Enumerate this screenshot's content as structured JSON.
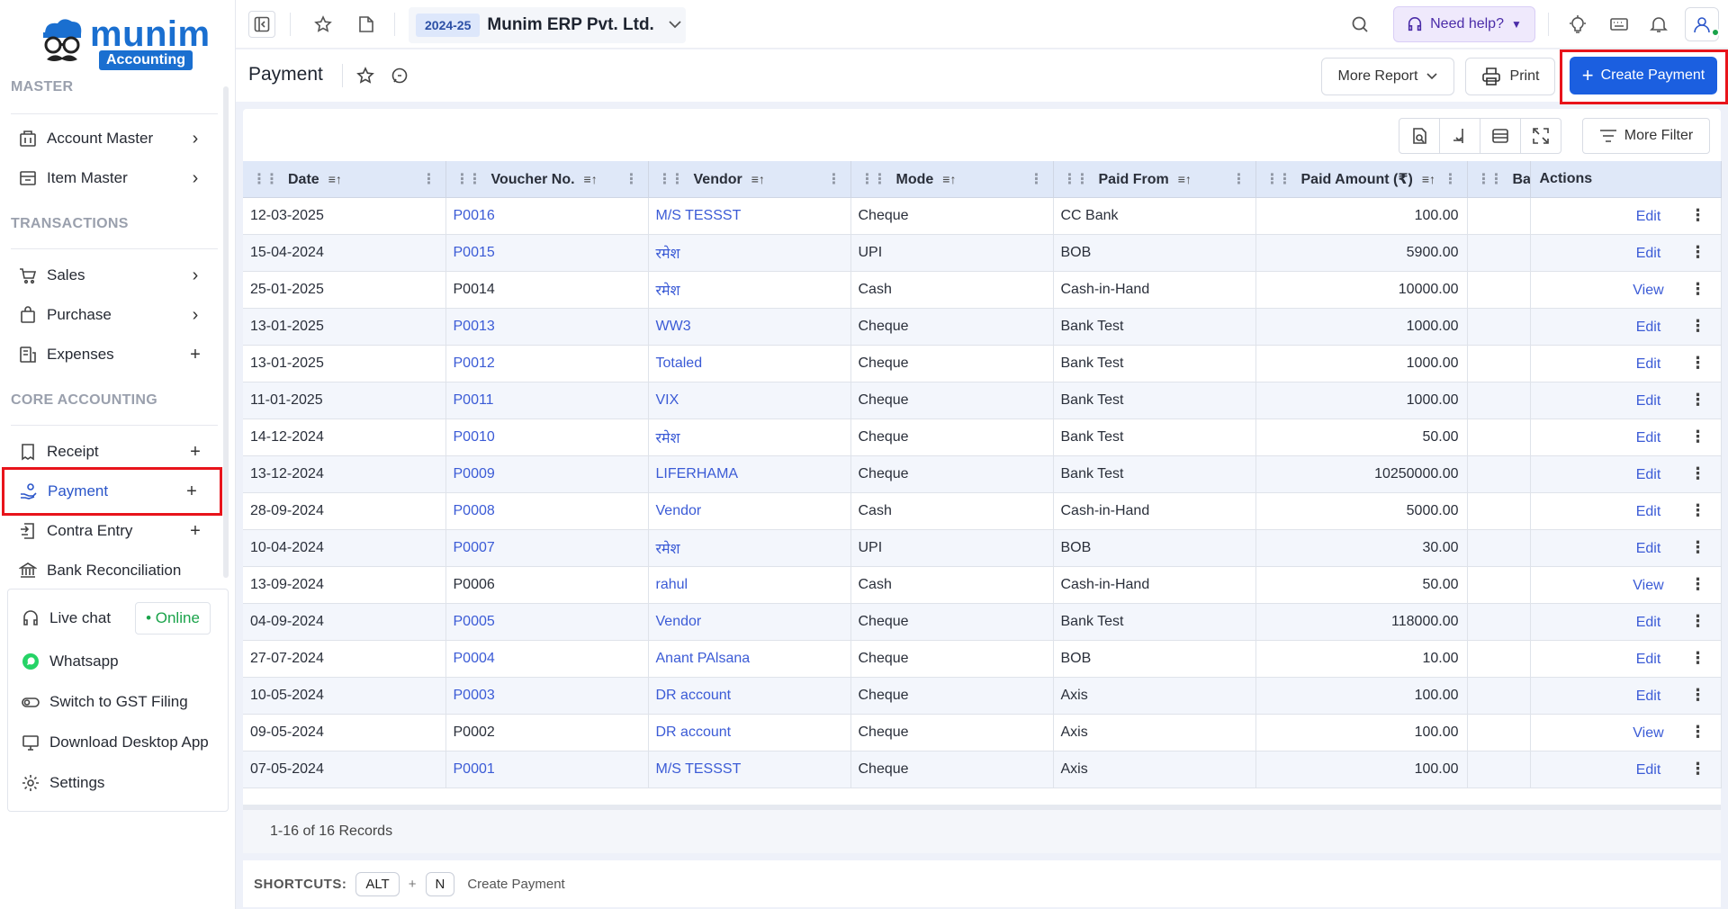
{
  "brand": {
    "name": "munim",
    "sub": "Accounting"
  },
  "sidebar": {
    "sections": [
      {
        "title": "MASTER"
      },
      {
        "title": "TRANSACTIONS"
      },
      {
        "title": "CORE ACCOUNTING"
      }
    ],
    "items": [
      {
        "label": "Account Master",
        "icon": "building-icon",
        "tail": "›"
      },
      {
        "label": "Item Master",
        "icon": "box-icon",
        "tail": "›"
      },
      {
        "label": "Sales",
        "icon": "cart-icon",
        "tail": "›"
      },
      {
        "label": "Purchase",
        "icon": "bag-icon",
        "tail": "›"
      },
      {
        "label": "Expenses",
        "icon": "expense-icon",
        "tail": "+"
      },
      {
        "label": "Receipt",
        "icon": "receipt-icon",
        "tail": "+"
      },
      {
        "label": "Payment",
        "icon": "payment-hand-icon",
        "tail": "+"
      },
      {
        "label": "Contra Entry",
        "icon": "contra-icon",
        "tail": "+"
      },
      {
        "label": "Bank Reconciliation",
        "icon": "bank-icon",
        "tail": ""
      }
    ],
    "bottom": [
      {
        "label": "Live chat",
        "icon": "headset-icon"
      },
      {
        "label": "Whatsapp",
        "icon": "whatsapp-icon"
      },
      {
        "label": "Switch to GST Filing",
        "icon": "toggle-icon"
      },
      {
        "label": "Download Desktop App",
        "icon": "monitor-icon"
      },
      {
        "label": "Settings",
        "icon": "gear-icon"
      }
    ],
    "online_label": "• Online"
  },
  "topbar": {
    "fy": "2024-25",
    "company": "Munim ERP Pvt. Ltd.",
    "help": "Need help?"
  },
  "page": {
    "title": "Payment",
    "more_report": "More Report",
    "print": "Print",
    "create": "Create Payment"
  },
  "grid": {
    "more_filter": "More Filter",
    "columns": [
      "Date",
      "Voucher No.",
      "Vendor",
      "Mode",
      "Paid From",
      "Paid Amount (₹)",
      "Balar",
      "Actions"
    ],
    "rows": [
      {
        "date": "12-03-2025",
        "voucher": "P0016",
        "vendor": "M/S TESSST",
        "mode": "Cheque",
        "from": "CC Bank",
        "amount": "100.00",
        "action": "Edit",
        "voucher_link": true
      },
      {
        "date": "15-04-2024",
        "voucher": "P0015",
        "vendor": "रमेश",
        "mode": "UPI",
        "from": "BOB",
        "amount": "5900.00",
        "action": "Edit",
        "voucher_link": true
      },
      {
        "date": "25-01-2025",
        "voucher": "P0014",
        "vendor": "रमेश",
        "mode": "Cash",
        "from": "Cash-in-Hand",
        "amount": "10000.00",
        "action": "View",
        "voucher_link": false
      },
      {
        "date": "13-01-2025",
        "voucher": "P0013",
        "vendor": "WW3",
        "mode": "Cheque",
        "from": "Bank Test",
        "amount": "1000.00",
        "action": "Edit",
        "voucher_link": true
      },
      {
        "date": "13-01-2025",
        "voucher": "P0012",
        "vendor": "Totaled",
        "mode": "Cheque",
        "from": "Bank Test",
        "amount": "1000.00",
        "action": "Edit",
        "voucher_link": true
      },
      {
        "date": "11-01-2025",
        "voucher": "P0011",
        "vendor": "VIX",
        "mode": "Cheque",
        "from": "Bank Test",
        "amount": "1000.00",
        "action": "Edit",
        "voucher_link": true
      },
      {
        "date": "14-12-2024",
        "voucher": "P0010",
        "vendor": "रमेश",
        "mode": "Cheque",
        "from": "Bank Test",
        "amount": "50.00",
        "action": "Edit",
        "voucher_link": true
      },
      {
        "date": "13-12-2024",
        "voucher": "P0009",
        "vendor": "LIFERHAMA",
        "mode": "Cheque",
        "from": "Bank Test",
        "amount": "10250000.00",
        "action": "Edit",
        "voucher_link": true
      },
      {
        "date": "28-09-2024",
        "voucher": "P0008",
        "vendor": "Vendor",
        "mode": "Cash",
        "from": "Cash-in-Hand",
        "amount": "5000.00",
        "action": "Edit",
        "voucher_link": true
      },
      {
        "date": "10-04-2024",
        "voucher": "P0007",
        "vendor": "रमेश",
        "mode": "UPI",
        "from": "BOB",
        "amount": "30.00",
        "action": "Edit",
        "voucher_link": true
      },
      {
        "date": "13-09-2024",
        "voucher": "P0006",
        "vendor": "rahul",
        "mode": "Cash",
        "from": "Cash-in-Hand",
        "amount": "50.00",
        "action": "View",
        "voucher_link": false
      },
      {
        "date": "04-09-2024",
        "voucher": "P0005",
        "vendor": "Vendor",
        "mode": "Cheque",
        "from": "Bank Test",
        "amount": "118000.00",
        "action": "Edit",
        "voucher_link": true
      },
      {
        "date": "27-07-2024",
        "voucher": "P0004",
        "vendor": "Anant PAlsana",
        "mode": "Cheque",
        "from": "BOB",
        "amount": "10.00",
        "action": "Edit",
        "voucher_link": true
      },
      {
        "date": "10-05-2024",
        "voucher": "P0003",
        "vendor": "DR account",
        "mode": "Cheque",
        "from": "Axis",
        "amount": "100.00",
        "action": "Edit",
        "voucher_link": true
      },
      {
        "date": "09-05-2024",
        "voucher": "P0002",
        "vendor": "DR account",
        "mode": "Cheque",
        "from": "Axis",
        "amount": "100.00",
        "action": "View",
        "voucher_link": false
      },
      {
        "date": "07-05-2024",
        "voucher": "P0001",
        "vendor": "M/S TESSST",
        "mode": "Cheque",
        "from": "Axis",
        "amount": "100.00",
        "action": "Edit",
        "voucher_link": true
      }
    ],
    "records": "1-16 of 16 Records"
  },
  "shortcuts": {
    "title": "SHORTCUTS:",
    "key1": "ALT",
    "plus": "+",
    "key2": "N",
    "action": "Create Payment"
  },
  "colors": {
    "primary": "#1b5fe0",
    "highlight": "#e8141b",
    "link": "#3b5bd6",
    "online": "#1aa34a"
  }
}
